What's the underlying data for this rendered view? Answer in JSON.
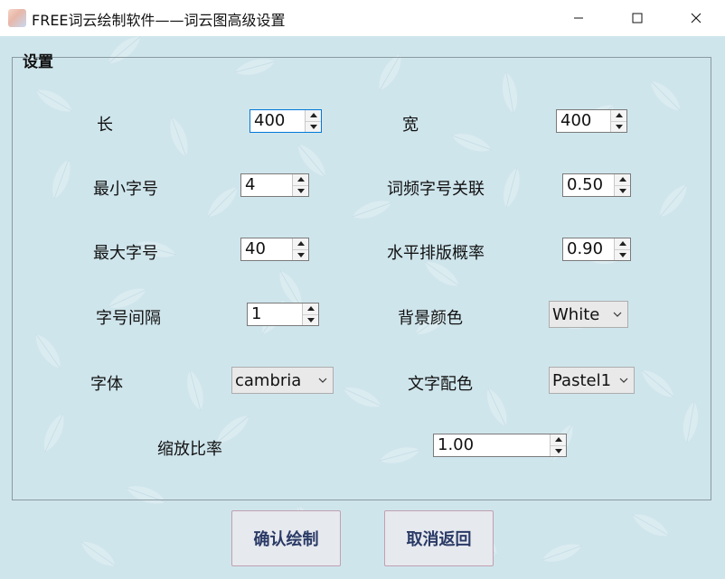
{
  "window": {
    "title": "FREE词云绘制软件——词云图高级设置",
    "minimize_icon": "minimize-icon",
    "maximize_icon": "maximize-icon",
    "close_icon": "close-icon"
  },
  "group": {
    "title": "设置"
  },
  "fields": {
    "length": {
      "label": "长",
      "value": "400"
    },
    "width": {
      "label": "宽",
      "value": "400"
    },
    "min_font": {
      "label": "最小字号",
      "value": "4"
    },
    "freq_relation": {
      "label": "词频字号关联",
      "value": "0.50"
    },
    "max_font": {
      "label": "最大字号",
      "value": "40"
    },
    "horizontal_prob": {
      "label": "水平排版概率",
      "value": "0.90"
    },
    "font_step": {
      "label": "字号间隔",
      "value": "1"
    },
    "bg_color": {
      "label": "背景颜色",
      "value": "White"
    },
    "font": {
      "label": "字体",
      "value": "cambria"
    },
    "text_colormap": {
      "label": "文字配色",
      "value": "Pastel1"
    },
    "scale": {
      "label": "缩放比率",
      "value": "1.00"
    }
  },
  "buttons": {
    "confirm": "确认绘制",
    "cancel": "取消返回"
  },
  "colors": {
    "background": "#cfe5ec",
    "button_text": "#2a3a66",
    "focus_border": "#0078d7"
  }
}
